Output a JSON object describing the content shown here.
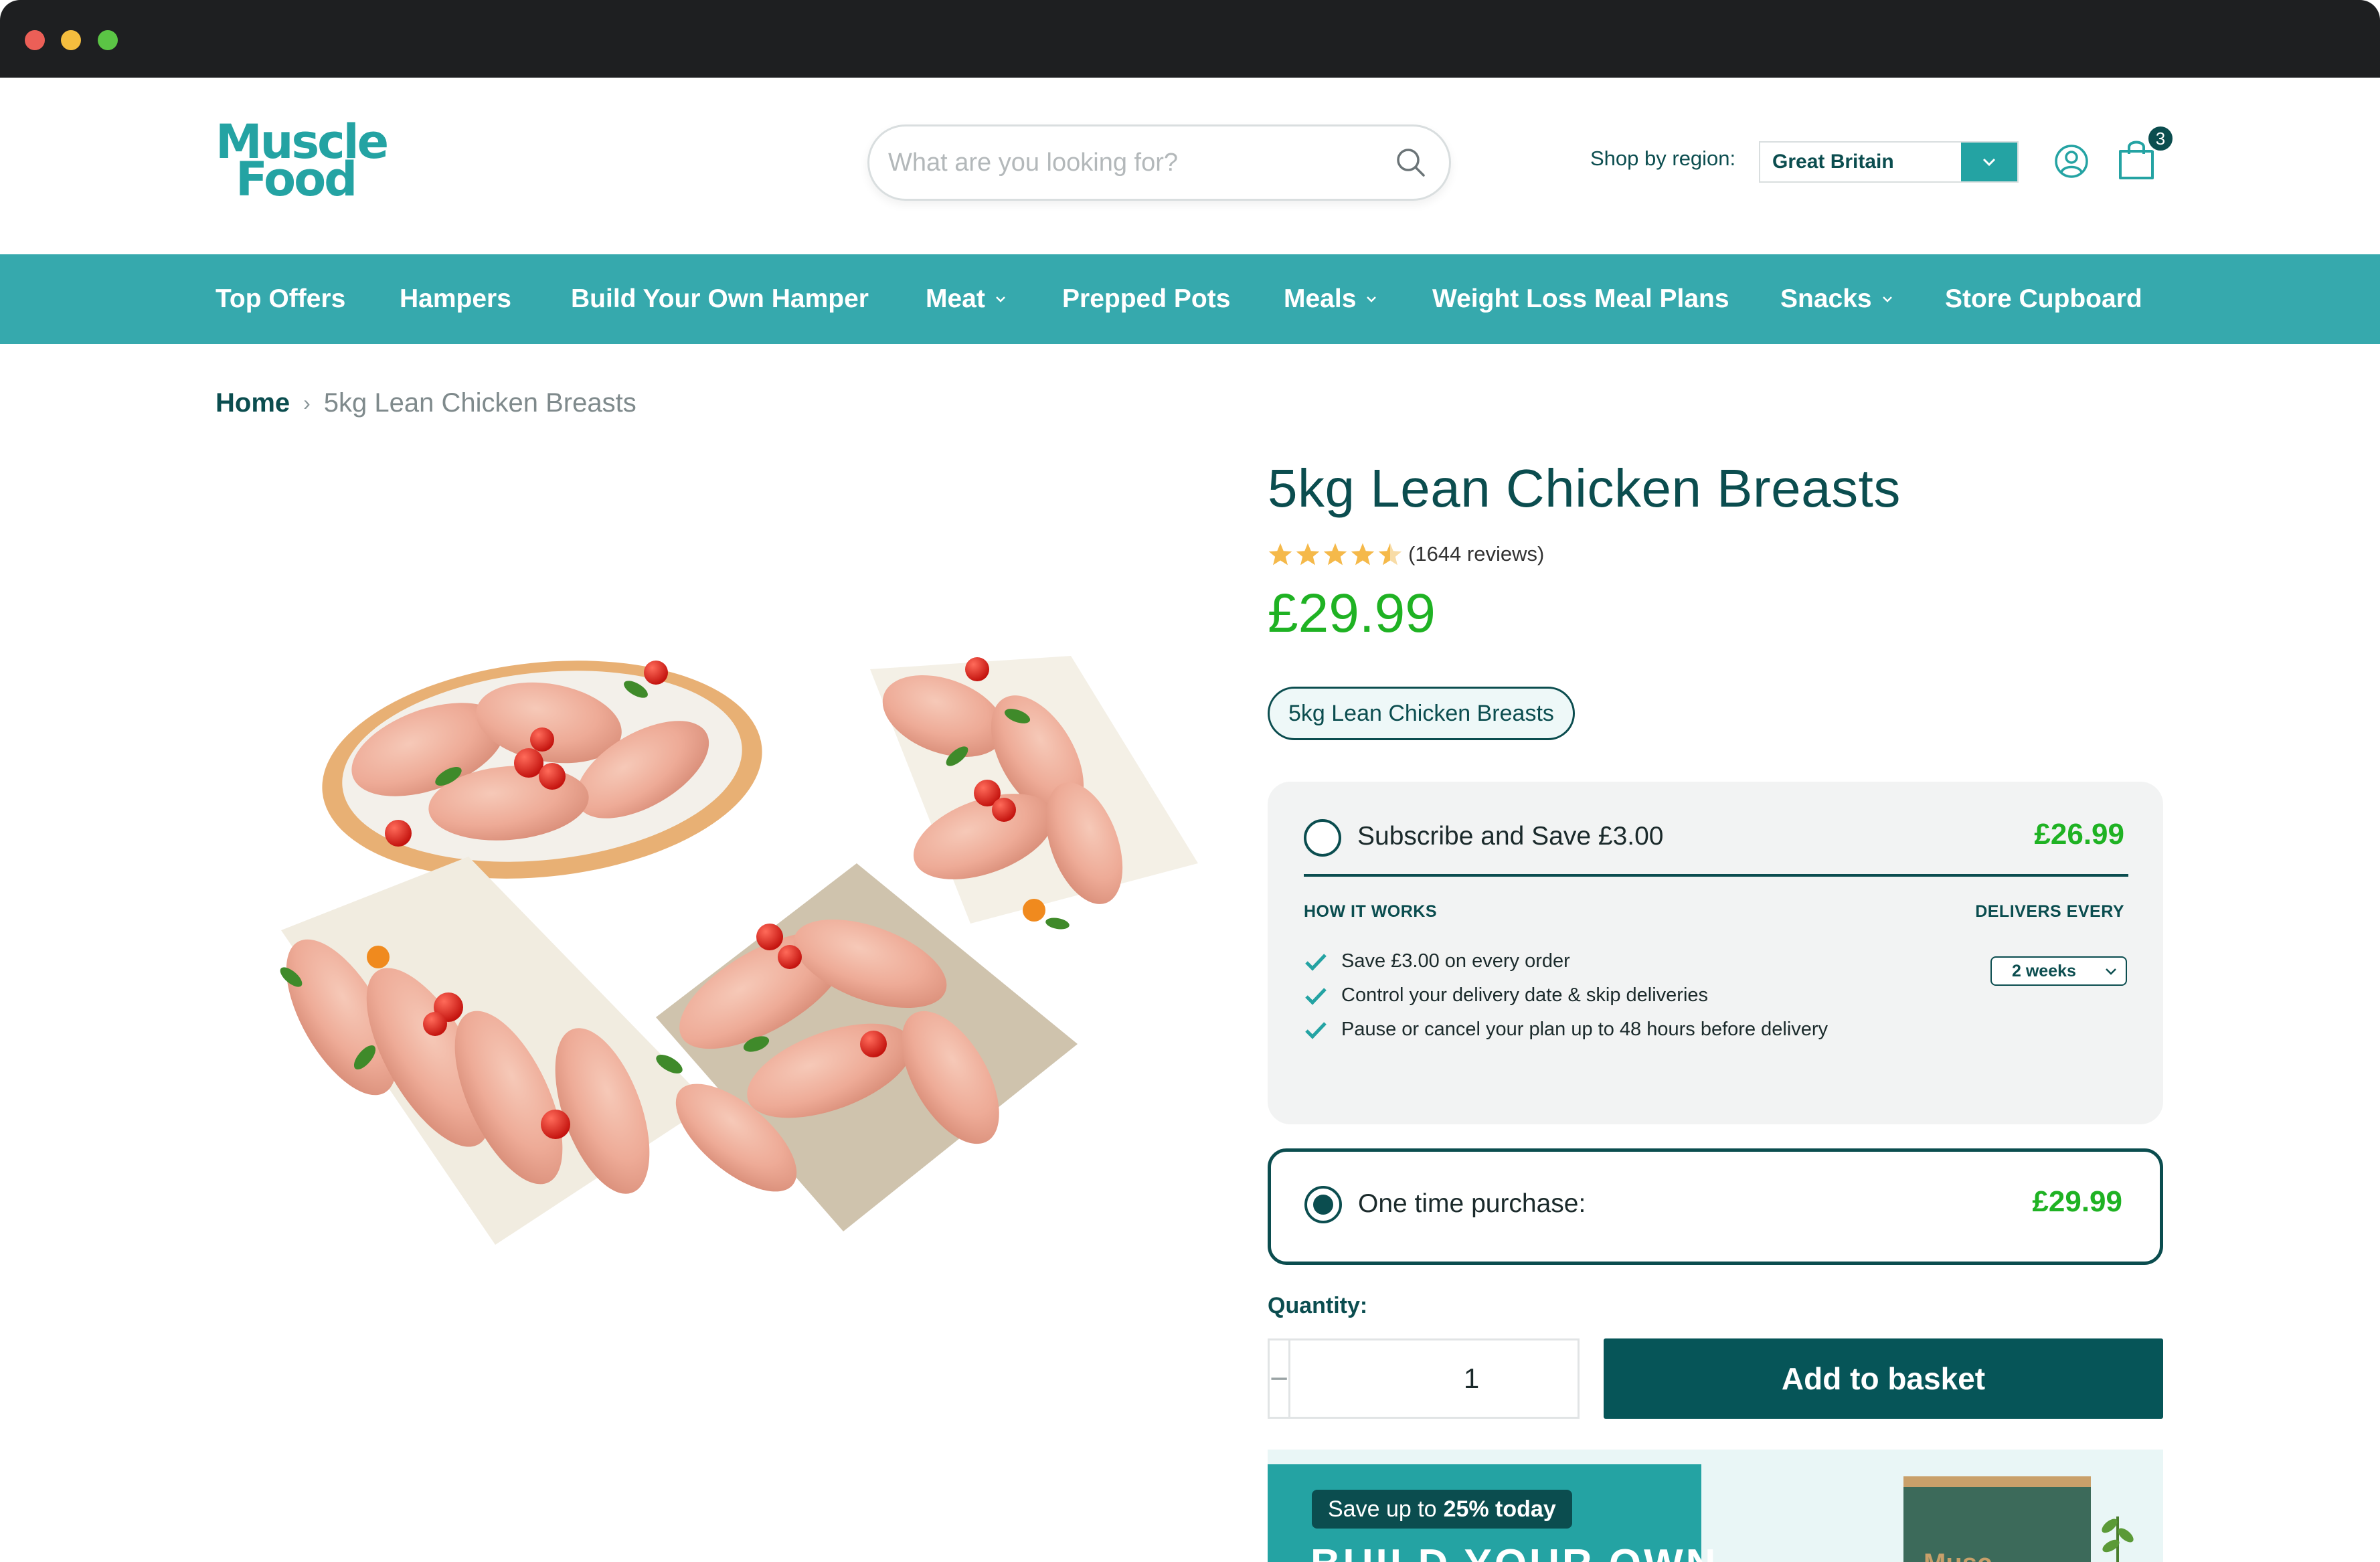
{
  "header": {
    "logo_line1": "Muscle",
    "logo_line2": "Food",
    "search_placeholder": "What are you looking for?",
    "region_label": "Shop by region:",
    "region_value": "Great Britain",
    "cart_count": "3"
  },
  "nav": {
    "items": [
      {
        "label": "Top Offers",
        "has_dropdown": false
      },
      {
        "label": "Hampers",
        "has_dropdown": false
      },
      {
        "label": "Build Your Own Hamper",
        "has_dropdown": false
      },
      {
        "label": "Meat",
        "has_dropdown": true
      },
      {
        "label": "Prepped Pots",
        "has_dropdown": false
      },
      {
        "label": "Meals",
        "has_dropdown": true
      },
      {
        "label": "Weight Loss Meal Plans",
        "has_dropdown": false
      },
      {
        "label": "Snacks",
        "has_dropdown": true
      },
      {
        "label": "Store Cupboard",
        "has_dropdown": false
      }
    ]
  },
  "breadcrumb": {
    "home": "Home",
    "separator": "›",
    "current": "5kg Lean Chicken Breasts"
  },
  "product": {
    "title": "5kg Lean Chicken Breasts",
    "rating": 4.5,
    "reviews": "(1644 reviews)",
    "price": "£29.99",
    "variant": "5kg Lean Chicken Breasts"
  },
  "subscription": {
    "label": "Subscribe and Save £3.00",
    "price": "£26.99",
    "selected": false,
    "how_title": "HOW IT WORKS",
    "delivers_title": "DELIVERS EVERY",
    "frequency": "2 weeks",
    "benefits": [
      "Save £3.00 on every order",
      "Control your delivery date & skip deliveries",
      "Pause or cancel your plan up to 48 hours before delivery"
    ]
  },
  "one_time": {
    "label": "One time purchase:",
    "price": "£29.99",
    "selected": true
  },
  "quantity": {
    "label": "Quantity:",
    "value": "1",
    "minus": "−",
    "plus": "+"
  },
  "add_to_basket": "Add to basket",
  "promo": {
    "pill_prefix": "Save up to",
    "pill_bold": "25% today",
    "heading": "BUILD YOUR OWN",
    "box_text": "Musc"
  },
  "colors": {
    "teal": "#36a9ad",
    "dark_teal": "#0b4d4f",
    "price_green": "#1fb223",
    "star": "#f5b94a"
  }
}
